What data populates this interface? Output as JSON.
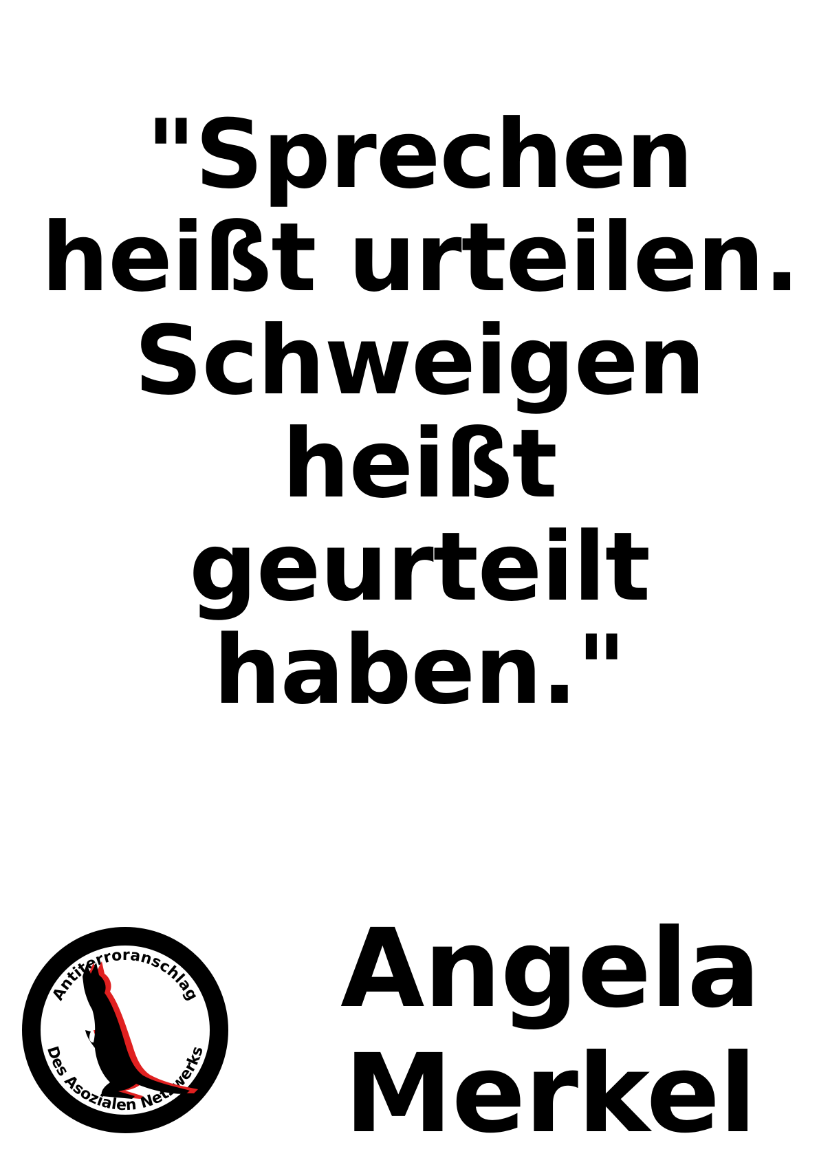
{
  "quote": {
    "lines": [
      "\"Sprechen",
      "heißt urteilen.",
      "Schweigen",
      "heißt",
      "geurteilt",
      "haben.\""
    ]
  },
  "author": {
    "first_name": "Angela",
    "last_name": "Merkel"
  },
  "logo": {
    "top_text": "Antiterroranschlag",
    "bottom_text": "Des Asozialen Netzwerks",
    "icon": "kangaroo-icon",
    "colors": {
      "ring": "#000000",
      "silhouette": "#000000",
      "shadow": "#e02020"
    }
  }
}
